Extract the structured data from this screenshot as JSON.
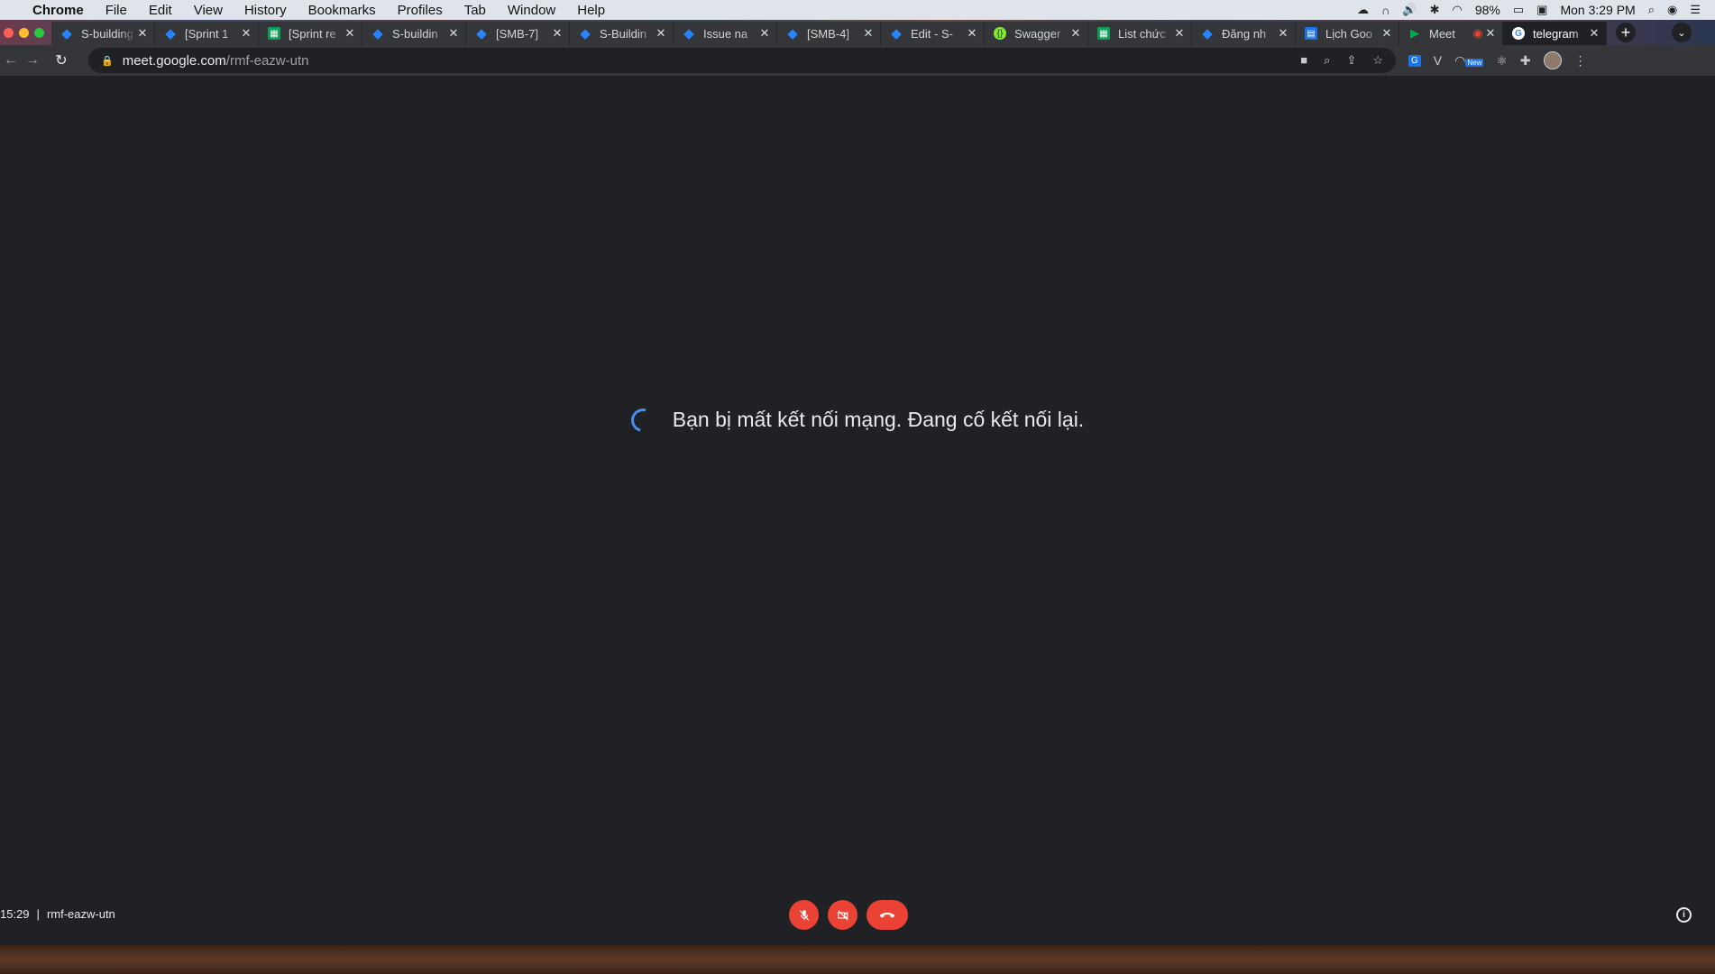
{
  "menubar": {
    "app": "Chrome",
    "items": [
      "File",
      "Edit",
      "View",
      "History",
      "Bookmarks",
      "Profiles",
      "Tab",
      "Window",
      "Help"
    ],
    "battery": "98%",
    "clock": "Mon 3:29 PM"
  },
  "tabs": [
    {
      "title": "S-building",
      "icon": "jira-icon"
    },
    {
      "title": "[Sprint 1",
      "icon": "jira-icon"
    },
    {
      "title": "[Sprint re",
      "icon": "sheets-icon"
    },
    {
      "title": "S-buildin",
      "icon": "jira-icon"
    },
    {
      "title": "[SMB-7]",
      "icon": "jira-icon"
    },
    {
      "title": "S-Buildin",
      "icon": "jira-icon"
    },
    {
      "title": "Issue na",
      "icon": "jira-icon"
    },
    {
      "title": "[SMB-4]",
      "icon": "jira-icon"
    },
    {
      "title": "Edit - S-",
      "icon": "jira-icon"
    },
    {
      "title": "Swagger",
      "icon": "swagger-icon"
    },
    {
      "title": "List chức",
      "icon": "sheets-icon"
    },
    {
      "title": "Đăng nh",
      "icon": "jira-icon"
    },
    {
      "title": "Lịch Goo",
      "icon": "calendar-icon"
    },
    {
      "title": "Meet",
      "icon": "meet-icon"
    },
    {
      "title": "telegram",
      "icon": "google-icon"
    }
  ],
  "address": {
    "host": "meet.google.com",
    "path": "/rmf-eazw-utn"
  },
  "extensions": {
    "new_badge": "New"
  },
  "meet": {
    "message": "Bạn bị mất kết nối mạng. Đang cố kết nối lại.",
    "time": "15:29",
    "separator": "|",
    "meeting_code": "rmf-eazw-utn"
  },
  "colors": {
    "background": "#202124",
    "danger": "#ea4335",
    "spinner": "#4a8cf0"
  }
}
